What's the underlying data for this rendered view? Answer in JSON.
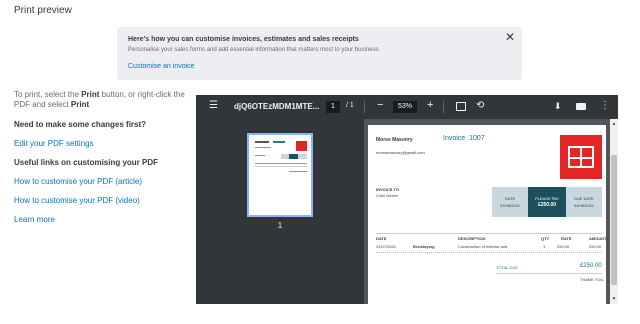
{
  "page": {
    "title": "Print preview"
  },
  "banner": {
    "title": "Here's how you can customise invoices, estimates and sales receipts",
    "text": "Personalise your sales forms and add essential information that matters most to your business.",
    "link": "Customise an invoice",
    "close": "✕"
  },
  "left": {
    "instr_a": "To print, select the ",
    "instr_b": "Print",
    "instr_c": " button, or right-click the PDF and select ",
    "instr_d": "Print",
    "need_changes": "Need to make some changes first?",
    "edit_pdf": "Edit your PDF settings",
    "useful_links": "Useful links on customising your PDF",
    "link_article": "How to customise your PDF (article)",
    "link_video": "How to customise your PDF (video)",
    "learn_more": "Learn more"
  },
  "viewer": {
    "menu": "☰",
    "doc_name": "djQ6OTEzMDM1MTE...",
    "page_current": "1",
    "page_sep": "/",
    "page_total": "1",
    "zoom_minus": "−",
    "zoom": "53%",
    "zoom_plus": "+",
    "rotate": "⟲",
    "download": "⬇",
    "more": "⋮",
    "thumb_num": "1"
  },
  "invoice": {
    "company": "Morse Masonry",
    "title": "Invoice",
    "number": "1007",
    "email": "morsemasonry@gmail.com",
    "invoice_to_label": "INVOICE TO",
    "invoice_to": "Colin Dexter",
    "date_label": "DATE",
    "date": "07/08/2021",
    "please_pay_label": "PLEASE PAY",
    "please_pay": "£250.00",
    "due_date_label": "DUE DATE",
    "due_date": "04/08/2021",
    "columns": [
      "DATE",
      "DESCRIPTION",
      "QTY",
      "RATE",
      "AMOUNT"
    ],
    "row": {
      "date": "21/07/2021",
      "item": "Bricklaying",
      "description": "Construction of exterior wall",
      "qty": "1",
      "rate": "250.00",
      "amount": "250.00"
    },
    "total_due_label": "TOTAL DUE",
    "total_due": "£250.00",
    "thank_you": "THANK YOU."
  },
  "colors": {
    "accent": "#0077c5",
    "logo": "#e32525",
    "please_pay_bg": "#1d4f5c",
    "date_bg": "#c8d8de"
  }
}
